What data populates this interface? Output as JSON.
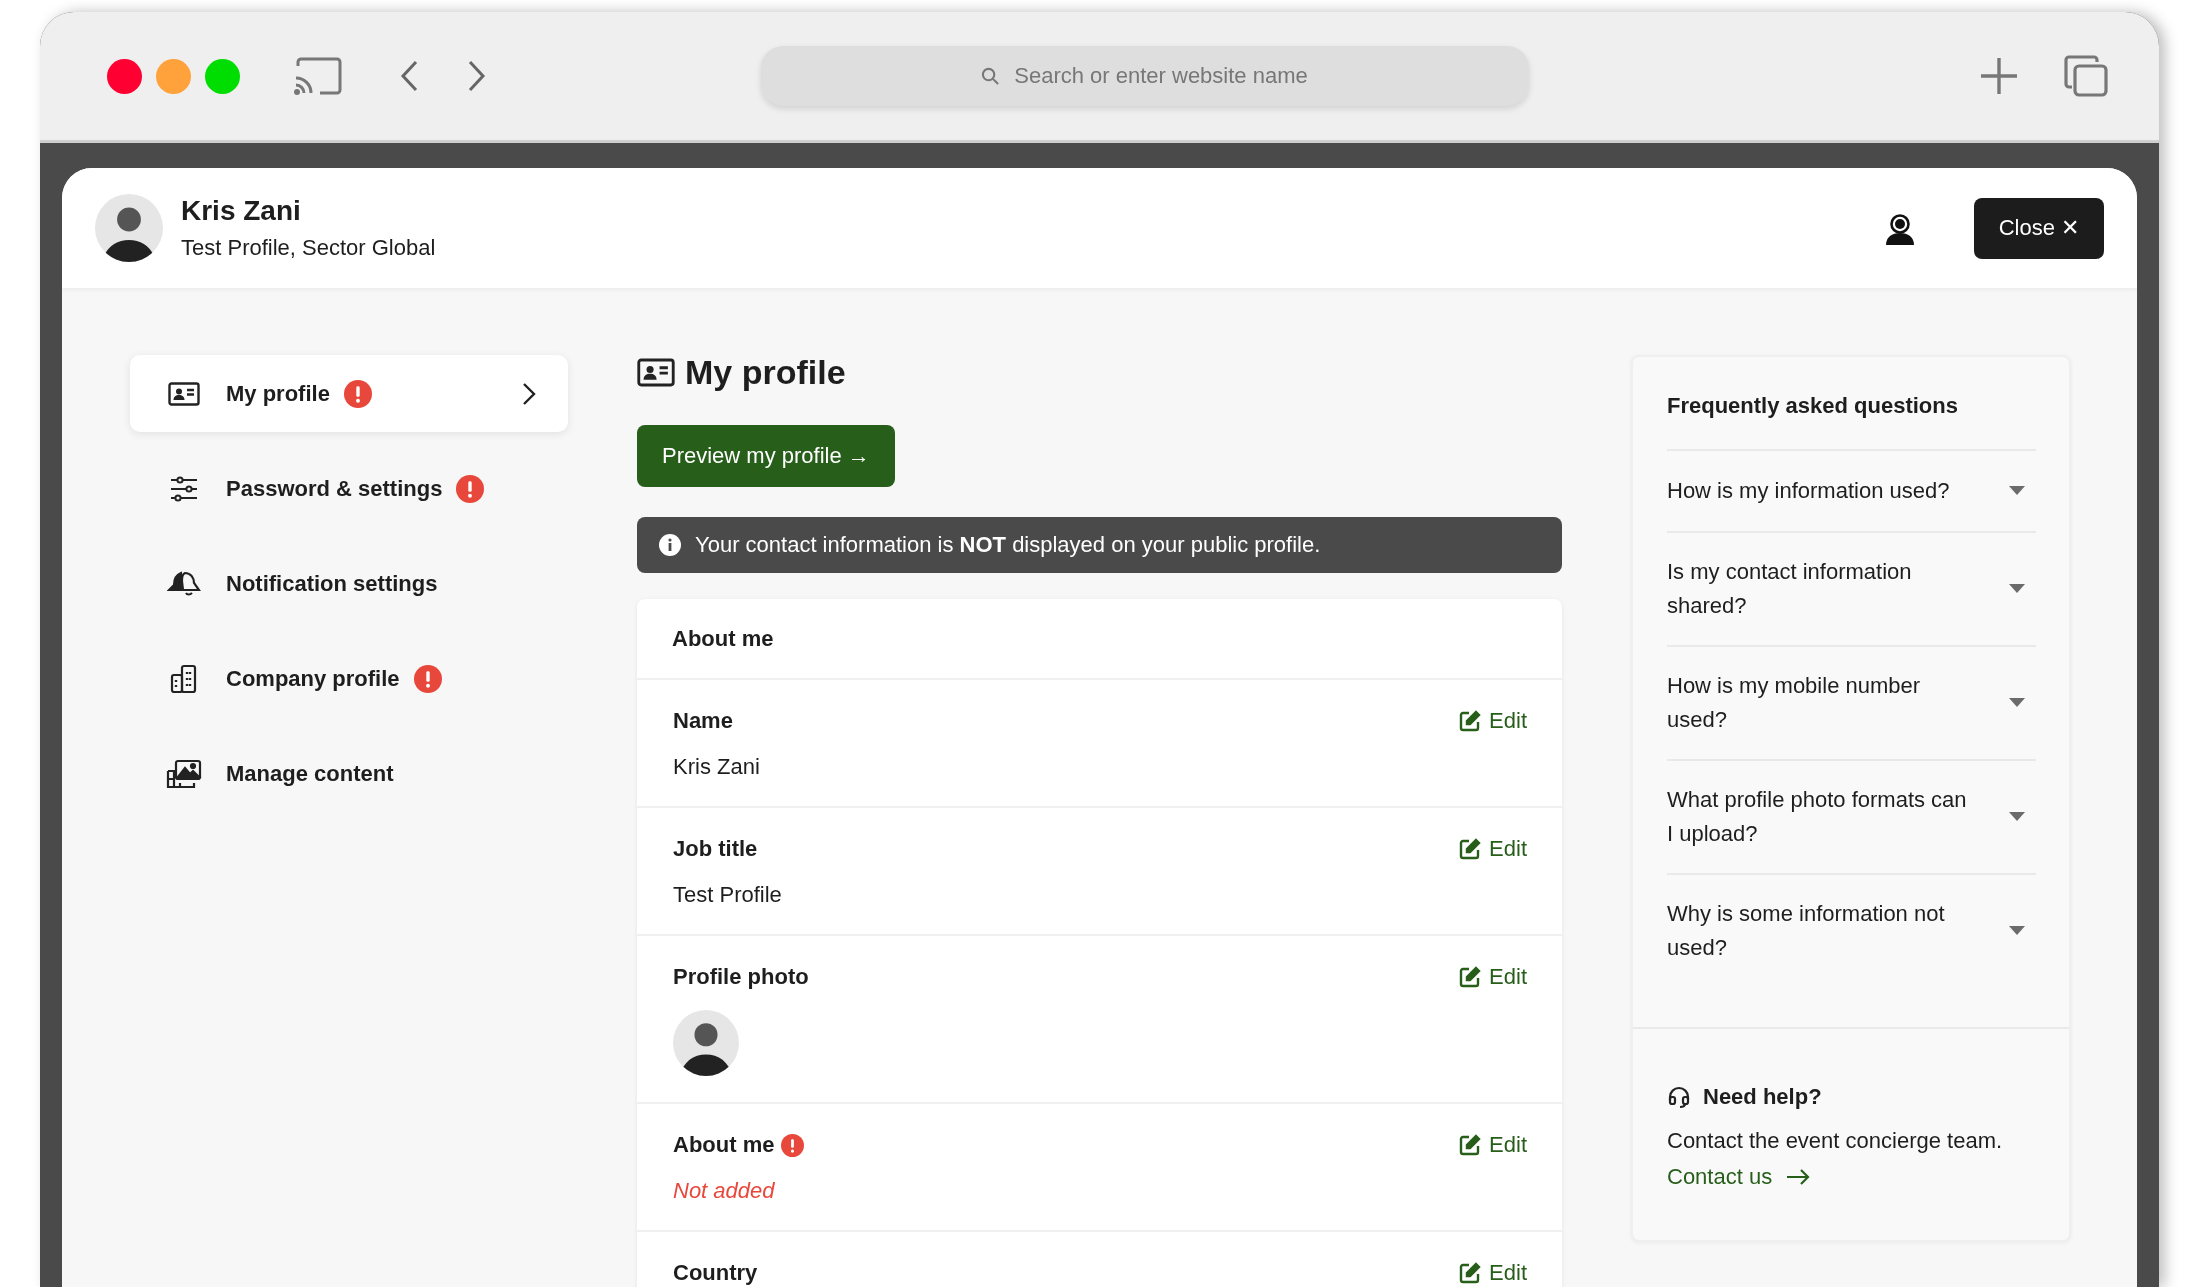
{
  "browser": {
    "address_placeholder": "Search or enter website name"
  },
  "header": {
    "name": "Kris Zani",
    "subtitle": "Test Profile, Sector Global",
    "close_label": "Close ✕"
  },
  "sidebar": {
    "items": [
      {
        "label": "My profile",
        "kind": "id-card",
        "alert": true,
        "selected": true
      },
      {
        "label": "Password & settings",
        "kind": "sliders",
        "alert": true,
        "selected": false
      },
      {
        "label": "Notification settings",
        "kind": "bell",
        "alert": false,
        "selected": false
      },
      {
        "label": "Company profile",
        "kind": "building",
        "alert": true,
        "selected": false
      },
      {
        "label": "Manage content",
        "kind": "images",
        "alert": false,
        "selected": false
      }
    ]
  },
  "main": {
    "title": "My profile",
    "preview_button": "Preview my profile →",
    "notice": "Your contact information is **NOT** displayed on your public profile.",
    "section_title": "About me",
    "fields": [
      {
        "label": "Name",
        "kind": "text",
        "value": "Kris Zani",
        "alert": false,
        "edit": "Edit"
      },
      {
        "label": "Job title",
        "kind": "text",
        "value": "Test Profile",
        "alert": false,
        "edit": "Edit"
      },
      {
        "label": "Profile photo",
        "kind": "photo",
        "alert": false,
        "edit": "Edit"
      },
      {
        "label": "About me",
        "kind": "missing",
        "value": "Not added",
        "alert": true,
        "edit": "Edit"
      },
      {
        "label": "Country",
        "kind": "text",
        "alert": false,
        "edit": "Edit"
      }
    ]
  },
  "faq": {
    "title": "Frequently asked questions",
    "questions": [
      {
        "text": "How is my information used?",
        "expanded": false
      },
      {
        "text": "Is my contact information shared?",
        "expanded": false
      },
      {
        "text": "How is my mobile number used?",
        "expanded": false
      },
      {
        "text": "What profile photo formats can I upload?",
        "expanded": false
      },
      {
        "text": "Why is some information not used?",
        "expanded": false
      }
    ],
    "help": {
      "title": "Need help?",
      "text": "Contact the event concierge team.",
      "link": "Contact us"
    }
  }
}
